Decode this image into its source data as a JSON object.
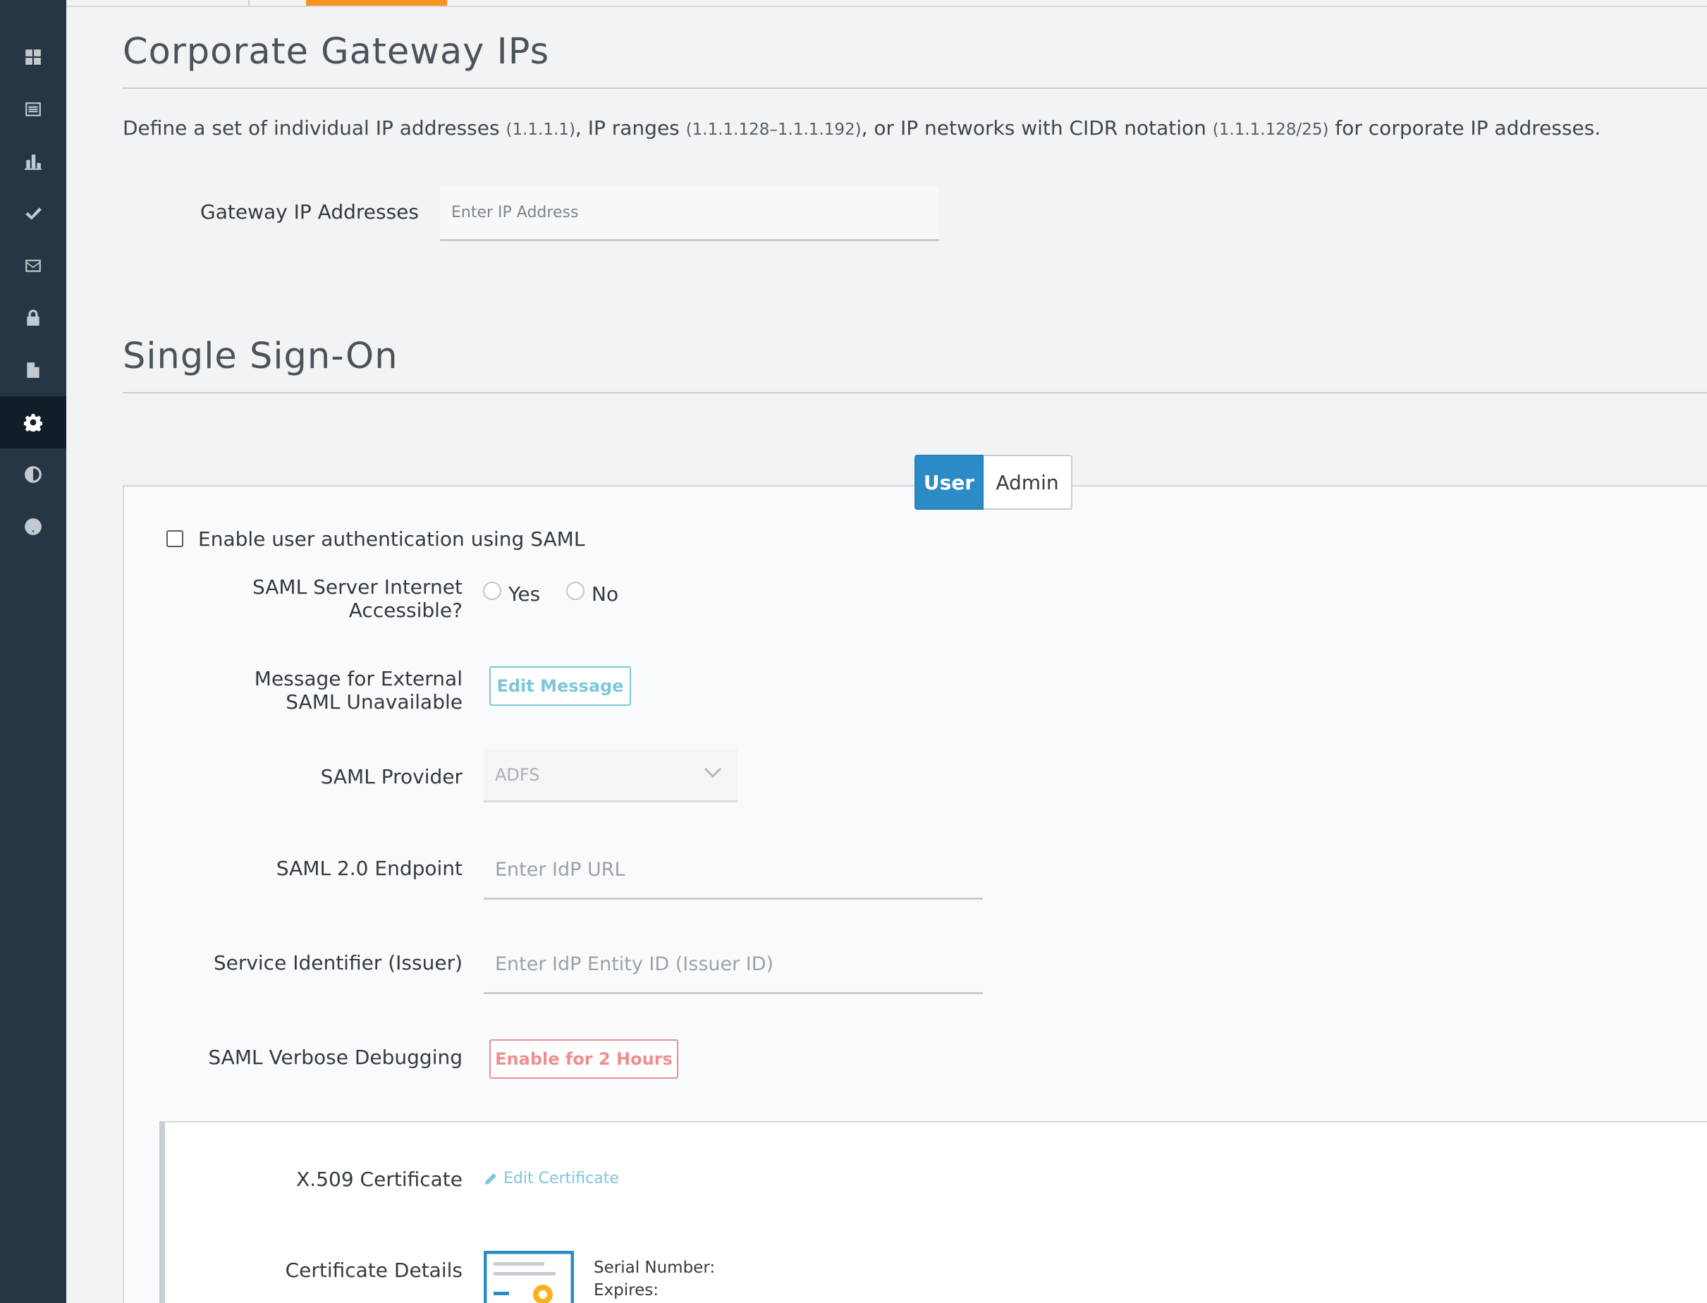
{
  "sidebar": {
    "items": [
      {
        "icon": "dashboard-icon"
      },
      {
        "icon": "list-icon"
      },
      {
        "icon": "chart-icon"
      },
      {
        "icon": "check-icon"
      },
      {
        "icon": "mail-icon"
      },
      {
        "icon": "lock-icon"
      },
      {
        "icon": "document-icon"
      },
      {
        "icon": "gear-icon",
        "active": true
      },
      {
        "icon": "contrast-icon"
      },
      {
        "icon": "help-icon"
      }
    ]
  },
  "gateway": {
    "title": "Corporate Gateway IPs",
    "desc_1": "Define a set of individual IP addresses",
    "desc_ex1": "(1.1.1.1)",
    "desc_2": ", IP ranges",
    "desc_ex2": "(1.1.1.128–1.1.1.192)",
    "desc_3": ", or IP networks with CIDR notation",
    "desc_ex3": "(1.1.1.128/25)",
    "desc_4": "for corporate IP addresses.",
    "field_label": "Gateway IP Addresses",
    "field_placeholder": "Enter IP Address"
  },
  "sso": {
    "title": "Single Sign-On",
    "tabs": {
      "user": "User",
      "admin": "Admin",
      "selected": "User"
    },
    "enable_label": "Enable user authentication using SAML",
    "enable_checked": false,
    "internet_label_1": "SAML Server Internet",
    "internet_label_2": "Accessible?",
    "yes_label": "Yes",
    "no_label": "No",
    "message_label_1": "Message for External",
    "message_label_2": "SAML Unavailable",
    "edit_message_label": "Edit Message",
    "provider_label": "SAML Provider",
    "provider_value": "ADFS",
    "endpoint_label": "SAML 2.0 Endpoint",
    "endpoint_placeholder": "Enter IdP URL",
    "issuer_label": "Service Identifier (Issuer)",
    "issuer_placeholder": "Enter IdP Entity ID (Issuer ID)",
    "debug_label": "SAML Verbose Debugging",
    "debug_button": "Enable for 2 Hours",
    "cert_label": "X.509 Certificate",
    "edit_cert_label": "Edit Certificate",
    "cert_details_label": "Certificate Details",
    "serial_label": "Serial Number:",
    "expires_label": "Expires:"
  },
  "colors": {
    "sidebar": "#263645",
    "accent": "#f7941d",
    "primary": "#2b8bc6",
    "info": "#7cc7d9",
    "danger": "#ec8f8f"
  }
}
